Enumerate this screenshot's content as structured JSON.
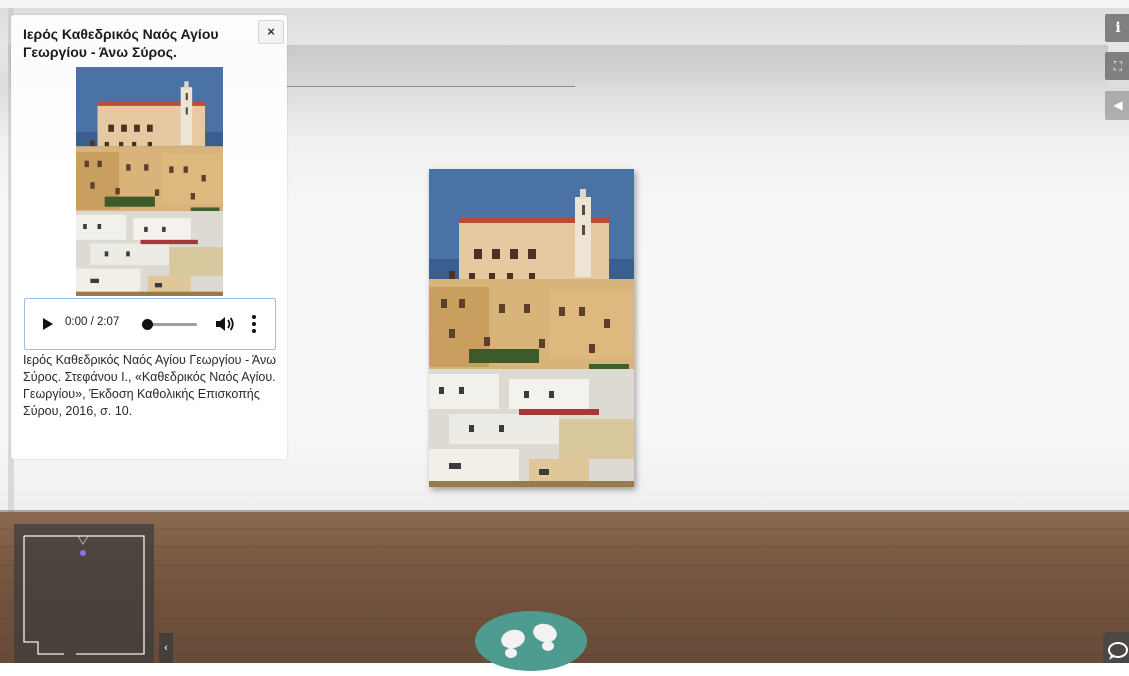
{
  "info_panel": {
    "title": "Ιερός Καθεδρικός Ναός Αγίου Γεωργίου - Άνω Σύρος.",
    "close_label": "×",
    "audio": {
      "time": "0:00 / 2:07",
      "progress": 0
    },
    "caption": "Ιερός Καθεδρικός Ναός Αγίου Γεωργίου - Άνω Σύρος. Στεφάνου Ι., «Καθεδρικός Ναός Αγίου. Γεωργίου», Έκδοση Καθολικής Επισκοπής Σύρου, 2016, σ. 10."
  },
  "toolbar": {
    "info_label": "i",
    "fullscreen_label": "⛶",
    "sound_label": "◀"
  },
  "minimap": {
    "collapse_label": "‹"
  },
  "icons": {
    "info": "info-icon",
    "fullscreen": "fullscreen-icon",
    "sound": "speaker-icon",
    "walk": "footsteps-icon",
    "chat": "chat-icon",
    "play": "play-icon",
    "volume": "volume-icon",
    "more": "more-vertical-icon"
  },
  "colors": {
    "walk_button": "#4e9b8f",
    "audio_border": "#9cc0e6"
  }
}
